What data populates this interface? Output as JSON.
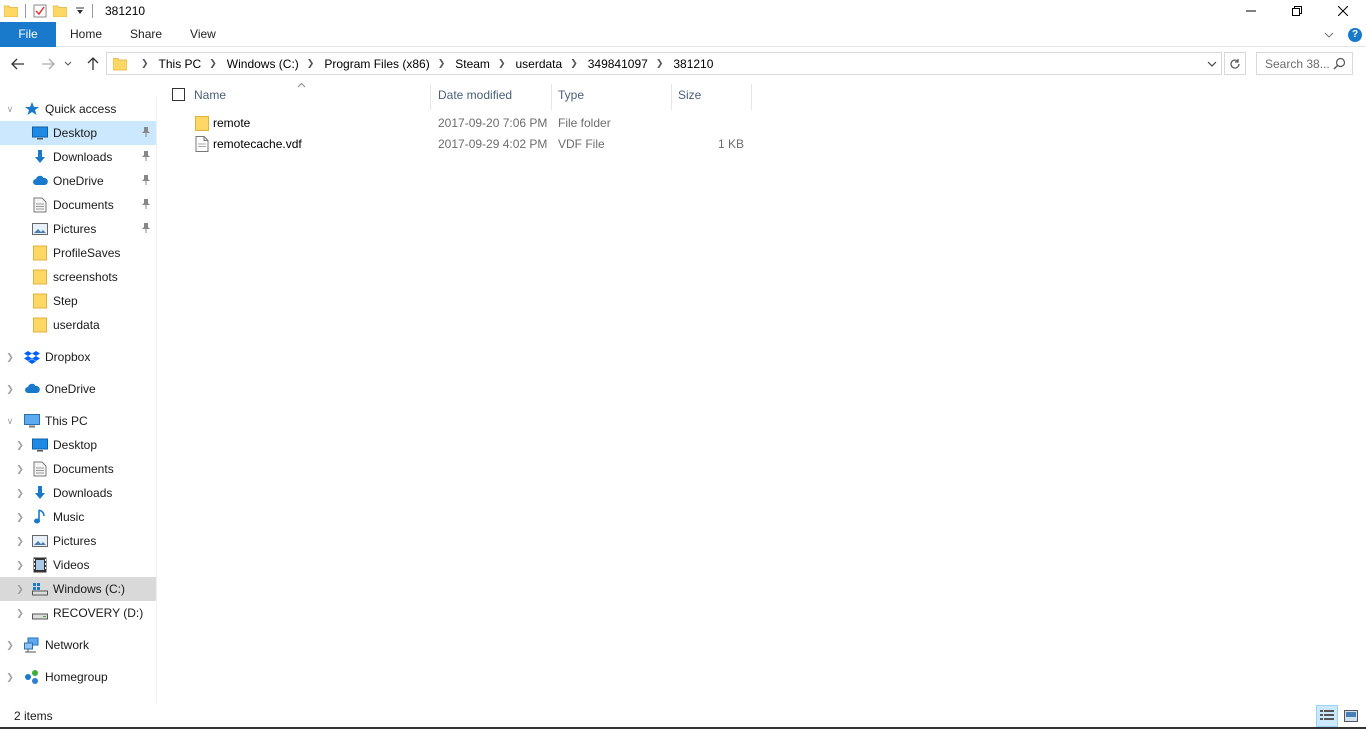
{
  "window": {
    "title": "381210"
  },
  "ribbon": {
    "tabs": [
      {
        "label": "File"
      },
      {
        "label": "Home"
      },
      {
        "label": "Share"
      },
      {
        "label": "View"
      }
    ]
  },
  "address": {
    "crumbs": [
      "This PC",
      "Windows (C:)",
      "Program Files (x86)",
      "Steam",
      "userdata",
      "349841097",
      "381210"
    ]
  },
  "search": {
    "placeholder": "Search 38..."
  },
  "sidebar": {
    "quick_access": {
      "label": "Quick access",
      "items": [
        {
          "label": "Desktop",
          "icon": "desktop-icon",
          "pinned": true
        },
        {
          "label": "Downloads",
          "icon": "download-icon",
          "pinned": true
        },
        {
          "label": "OneDrive",
          "icon": "onedrive-icon",
          "pinned": true
        },
        {
          "label": "Documents",
          "icon": "documents-icon",
          "pinned": true
        },
        {
          "label": "Pictures",
          "icon": "pictures-icon",
          "pinned": true
        },
        {
          "label": "ProfileSaves",
          "icon": "folder-icon",
          "pinned": false
        },
        {
          "label": "screenshots",
          "icon": "folder-icon",
          "pinned": false
        },
        {
          "label": "Step",
          "icon": "folder-icon",
          "pinned": false
        },
        {
          "label": "userdata",
          "icon": "folder-icon",
          "pinned": false
        }
      ]
    },
    "dropbox": {
      "label": "Dropbox"
    },
    "onedrive": {
      "label": "OneDrive"
    },
    "this_pc": {
      "label": "This PC",
      "items": [
        {
          "label": "Desktop",
          "icon": "desktop-icon"
        },
        {
          "label": "Documents",
          "icon": "documents-icon"
        },
        {
          "label": "Downloads",
          "icon": "download-icon"
        },
        {
          "label": "Music",
          "icon": "music-icon"
        },
        {
          "label": "Pictures",
          "icon": "pictures-icon"
        },
        {
          "label": "Videos",
          "icon": "videos-icon"
        },
        {
          "label": "Windows (C:)",
          "icon": "windows-drive-icon"
        },
        {
          "label": "RECOVERY (D:)",
          "icon": "drive-icon"
        }
      ]
    },
    "network": {
      "label": "Network"
    },
    "homegroup": {
      "label": "Homegroup"
    }
  },
  "filelist": {
    "columns": {
      "name": "Name",
      "date": "Date modified",
      "type": "Type",
      "size": "Size"
    },
    "rows": [
      {
        "name": "remote",
        "date": "2017-09-20 7:06 PM",
        "type": "File folder",
        "size": "",
        "icon": "folder-icon"
      },
      {
        "name": "remotecache.vdf",
        "date": "2017-09-29 4:02 PM",
        "type": "VDF File",
        "size": "1 KB",
        "icon": "file-icon"
      }
    ]
  },
  "status": {
    "count": "2 items"
  },
  "colors": {
    "accent": "#1979ca",
    "selection": "#cce8ff",
    "folder": "#ffd764"
  }
}
